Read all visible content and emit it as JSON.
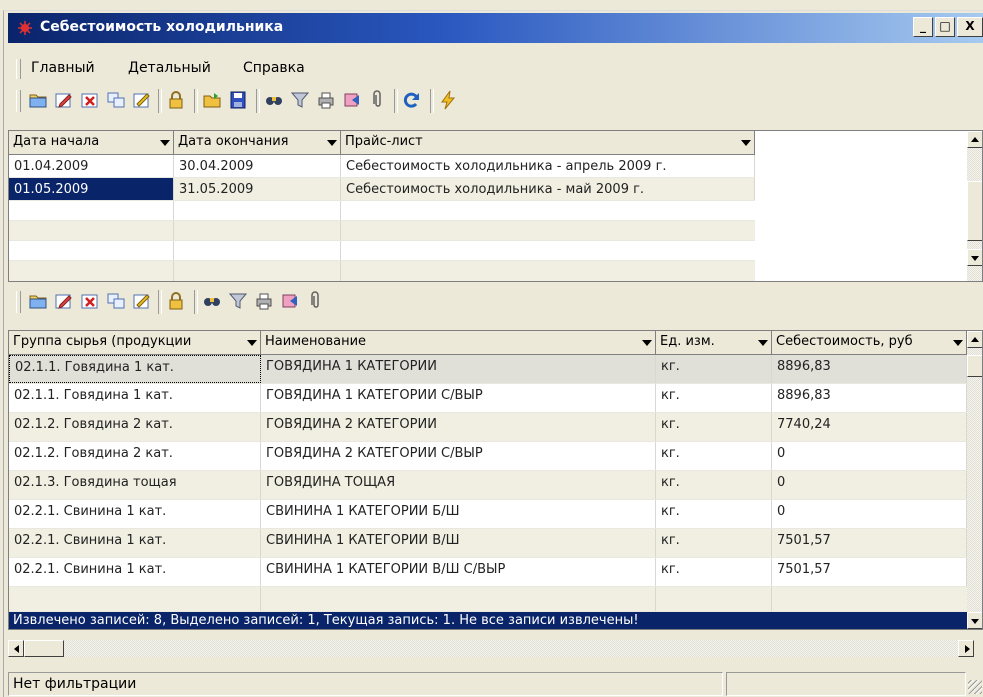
{
  "window": {
    "title": "Себестоимость холодильника",
    "controls": {
      "minimize": "_",
      "maximize": "□",
      "close": "X"
    }
  },
  "menu": [
    "Главный",
    "Детальный",
    "Справка"
  ],
  "top_toolbar": {
    "icons": [
      "open-folder-icon",
      "edit-icon",
      "delete-icon",
      "copy-icon",
      "edit-doc-icon",
      "lock-icon",
      "open-file-icon",
      "save-icon",
      "find-icon",
      "funnel-icon",
      "print-icon",
      "export-icon",
      "attach-icon",
      "refresh-icon",
      "lightning-icon"
    ]
  },
  "price_grid": {
    "columns": [
      "Дата начала",
      "Дата окончания",
      "Прайс-лист"
    ],
    "rows": [
      [
        "01.04.2009",
        "30.04.2009",
        "Себестоимость холодильника - апрель 2009 г."
      ],
      [
        "01.05.2009",
        "31.05.2009",
        "Себестоимость холодильника - май 2009 г."
      ]
    ],
    "selected_row": 1,
    "colors": {
      "selection": "#0a246a"
    }
  },
  "detail_toolbar": {
    "icons": [
      "open-folder-icon",
      "edit-icon",
      "delete-icon",
      "copy-icon",
      "edit-doc-icon",
      "lock-icon",
      "find-icon",
      "funnel-icon",
      "print-icon",
      "export-icon",
      "attach-icon"
    ]
  },
  "detail_grid": {
    "columns": [
      "Группа сырья (продукции",
      "Наименование",
      "Ед. изм.",
      "Себестоимость, руб"
    ],
    "rows": [
      [
        "02.1.1. Говядина 1 кат.",
        "ГОВЯДИНА 1 КАТЕГОРИИ",
        "кг.",
        "8896,83"
      ],
      [
        "02.1.1. Говядина 1 кат.",
        "ГОВЯДИНА 1 КАТЕГОРИИ С/ВЫР",
        "кг.",
        "8896,83"
      ],
      [
        "02.1.2. Говядина 2 кат.",
        "ГОВЯДИНА 2 КАТЕГОРИИ",
        "кг.",
        "7740,24"
      ],
      [
        "02.1.2. Говядина 2 кат.",
        "ГОВЯДИНА 2 КАТЕГОРИИ С/ВЫР",
        "кг.",
        "0"
      ],
      [
        "02.1.3. Говядина тощая",
        "ГОВЯДИНА ТОЩАЯ",
        "кг.",
        "0"
      ],
      [
        "02.2.1. Свинина 1 кат.",
        "СВИНИНА 1 КАТЕГОРИИ Б/Ш",
        "кг.",
        "0"
      ],
      [
        "02.2.1. Свинина 1 кат.",
        "СВИНИНА 1 КАТЕГОРИИ В/Ш",
        "кг.",
        "7501,57"
      ],
      [
        "02.2.1. Свинина 1 кат.",
        "СВИНИНА 1 КАТЕГОРИИ В/Ш С/ВЫР",
        "кг.",
        "7501,57"
      ]
    ],
    "selected_row": 0,
    "info_bar": "Извлечено записей: 8, Выделено записей: 1, Текущая запись: 1. Не все записи извлечены!"
  },
  "status_bar": {
    "left": "Нет фильтрации",
    "right": ""
  }
}
